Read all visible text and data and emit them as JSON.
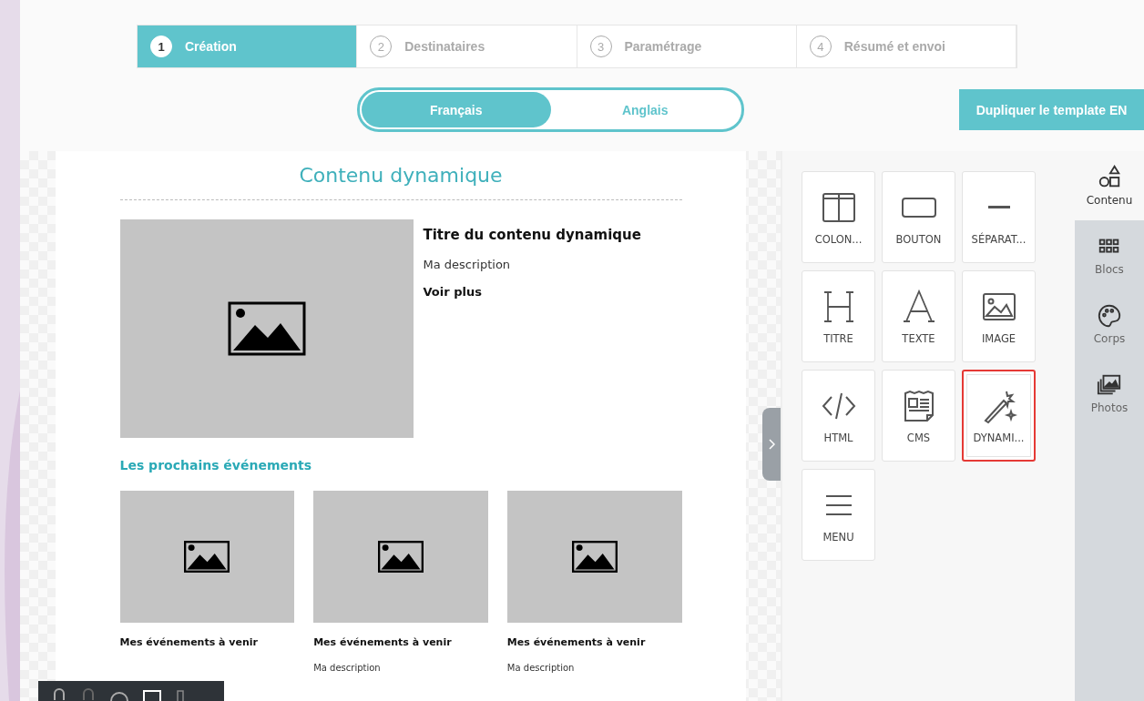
{
  "steps": [
    {
      "number": "1",
      "label": "Création",
      "selected": true
    },
    {
      "number": "2",
      "label": "Destinataires",
      "selected": false
    },
    {
      "number": "3",
      "label": "Paramétrage",
      "selected": false
    },
    {
      "number": "4",
      "label": "Résumé et envoi",
      "selected": false
    }
  ],
  "languages": [
    {
      "label": "Français",
      "selected": true
    },
    {
      "label": "Anglais",
      "selected": false
    }
  ],
  "duplicate_button": "Dupliquer le template EN",
  "email": {
    "title": "Contenu dynamique",
    "hero": {
      "title": "Titre du contenu dynamique",
      "description": "Ma description",
      "link": "Voir plus"
    },
    "section_title": "Les prochains événements",
    "cards": [
      {
        "title": "Mes événements à venir"
      },
      {
        "title": "Mes événements à venir",
        "description": "Ma description"
      },
      {
        "title": "Mes événements à venir",
        "description": "Ma description"
      }
    ]
  },
  "blocks": [
    {
      "kind": "columns",
      "label": "COLON...",
      "highlighted": false
    },
    {
      "kind": "button",
      "label": "BOUTON",
      "highlighted": false
    },
    {
      "kind": "divider",
      "label": "SÉPARAT...",
      "highlighted": false
    },
    {
      "kind": "heading",
      "label": "TITRE",
      "highlighted": false
    },
    {
      "kind": "text",
      "label": "TEXTE",
      "highlighted": false
    },
    {
      "kind": "image",
      "label": "IMAGE",
      "highlighted": false
    },
    {
      "kind": "html",
      "label": "HTML",
      "highlighted": false
    },
    {
      "kind": "cms",
      "label": "CMS",
      "highlighted": false
    },
    {
      "kind": "dynamic",
      "label": "DYNAMI...",
      "highlighted": true
    },
    {
      "kind": "menu",
      "label": "MENU",
      "highlighted": false
    }
  ],
  "side_tabs": [
    {
      "kind": "content",
      "label": "Contenu",
      "selected": true
    },
    {
      "kind": "blocks",
      "label": "Blocs",
      "selected": false
    },
    {
      "kind": "body",
      "label": "Corps",
      "selected": false
    },
    {
      "kind": "photos",
      "label": "Photos",
      "selected": false
    }
  ]
}
